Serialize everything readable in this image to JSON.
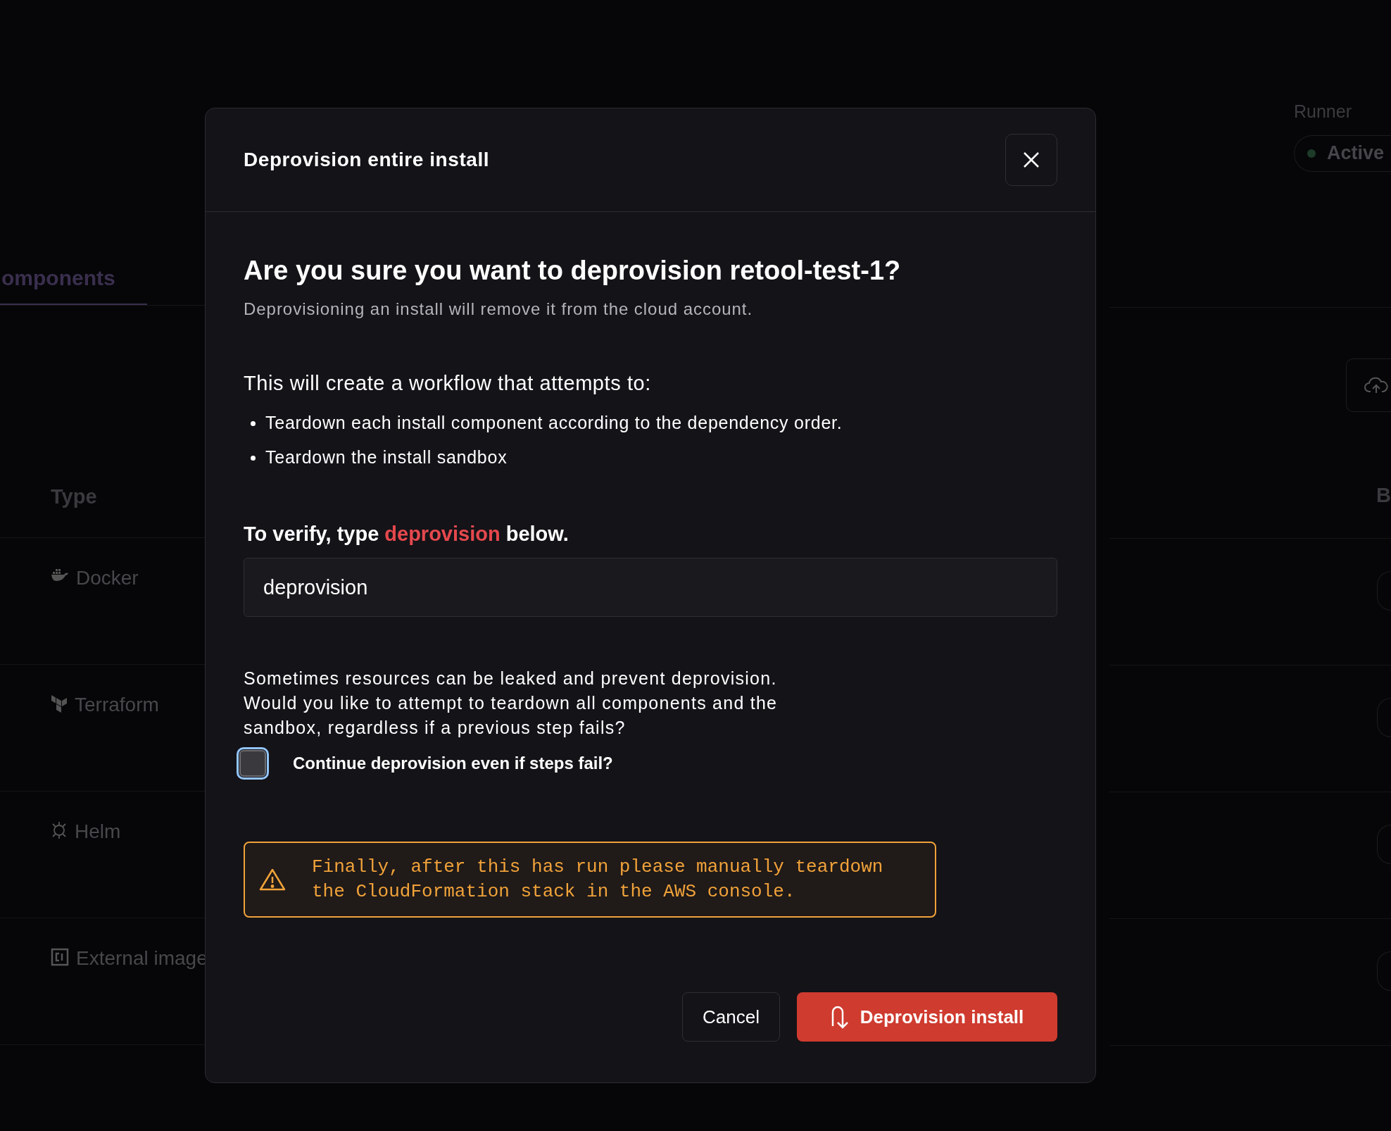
{
  "background": {
    "tabs": [
      {
        "label": "omponents",
        "selected": true
      }
    ],
    "runner": {
      "label": "Runner",
      "status": "Active",
      "color": "#1e3b2a"
    },
    "table": {
      "columns": [
        "Type",
        "B"
      ],
      "rows": [
        {
          "type": "Docker",
          "kind": "docker"
        },
        {
          "type": "Terraform",
          "kind": "terraform"
        },
        {
          "type": "Helm",
          "kind": "helm"
        },
        {
          "type": "External image",
          "kind": "image"
        }
      ]
    }
  },
  "dialog": {
    "title": "Deprovision entire install",
    "heading": "Are you sure you want to deprovision retool-test-1?",
    "description": "Deprovisioning an install will remove it from the cloud account.",
    "workflow_intro": "This will create a workflow that attempts to:",
    "steps": [
      "Teardown each install component according to the dependency order.",
      "Teardown the install sandbox"
    ],
    "verify": {
      "prefix": "To verify, type",
      "keyword": "deprovision",
      "suffix": "below."
    },
    "input": {
      "value": "deprovision"
    },
    "leak_note": "Sometimes resources can be leaked and prevent deprovision. Would you like to attempt to teardown all components and the sandbox, regardless if a previous step fails?",
    "checkbox": {
      "label": "Continue deprovision even if steps fail?",
      "checked": false,
      "focused": true
    },
    "warning": "Finally, after this has run please manually teardown the CloudFormation stack in the AWS console.",
    "buttons": [
      {
        "label": "Cancel",
        "kind": "secondary"
      },
      {
        "label": "Deprovision install",
        "kind": "danger"
      }
    ]
  }
}
